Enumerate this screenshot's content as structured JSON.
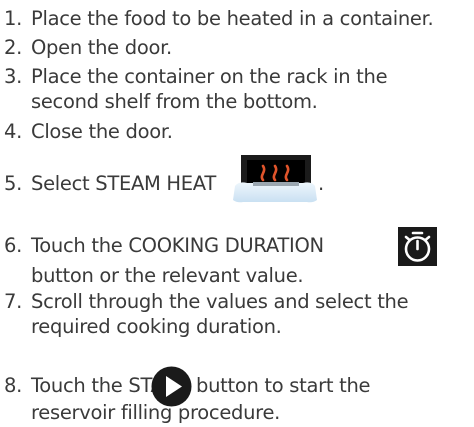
{
  "steps": [
    {
      "num": "1.",
      "lines": [
        "Place the food to be heated in a container."
      ]
    },
    {
      "num": "2.",
      "lines": [
        "Open the door."
      ]
    },
    {
      "num": "3.",
      "lines": [
        "Place the container on the rack in the",
        "second shelf from the bottom."
      ]
    },
    {
      "num": "4.",
      "lines": [
        "Close the door."
      ]
    },
    {
      "num": "5.",
      "before": "Select STEAM HEAT",
      "after": "."
    },
    {
      "num": "6.",
      "before": "Touch the COOKING DURATION",
      "lines": [
        "button or the relevant value."
      ]
    },
    {
      "num": "7.",
      "lines": [
        "Scroll through the values and select the",
        "required cooking duration."
      ]
    },
    {
      "num": "8.",
      "before": "Touch the START",
      "after": "button to start the",
      "lines": [
        "reservoir filling procedure."
      ]
    }
  ],
  "icons": {
    "steam_heat": "steam-heat-icon",
    "timer": "stopwatch-icon",
    "start": "play-icon"
  },
  "colors": {
    "text": "#3a3a3a",
    "icon_dark": "#1a1a1a",
    "steam_accent": "#e0542b",
    "steam_base": "#dcecf8"
  }
}
